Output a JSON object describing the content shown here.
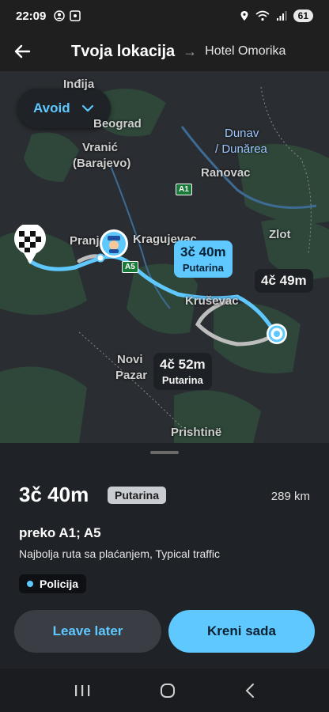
{
  "status_bar": {
    "time": "22:09",
    "battery": "61"
  },
  "header": {
    "title": "Tvoja lokacija",
    "destination": "Hotel Omorika"
  },
  "map": {
    "avoid_label": "Avoid",
    "place_labels": [
      "Inđija",
      "Beograd",
      "Vranić",
      "(Barajevo)",
      "Ranovac",
      "Zlot",
      "Pranj",
      "Kragujevac",
      "Kruševac",
      "Novi",
      "Pazar",
      "Prishtinë"
    ],
    "water_labels": [
      "Dunav",
      "/ Dunărea"
    ],
    "road_shields": [
      "A1",
      "A5"
    ],
    "routes": [
      {
        "time": "3č 40m",
        "sub": "Putarina"
      },
      {
        "time": "4č 49m",
        "sub": ""
      },
      {
        "time": "4č 52m",
        "sub": "Putarina"
      }
    ]
  },
  "sheet": {
    "eta": "3č 40m",
    "toll_badge": "Putarina",
    "distance": "289 km",
    "via": "preko A1; A5",
    "description": "Najbolja ruta sa plaćanjem, Typical traffic",
    "alert": "Policija",
    "leave_later": "Leave later",
    "go": "Kreni sada"
  },
  "colors": {
    "accent": "#5ec8ff",
    "sheet_bg": "#1f2226"
  }
}
